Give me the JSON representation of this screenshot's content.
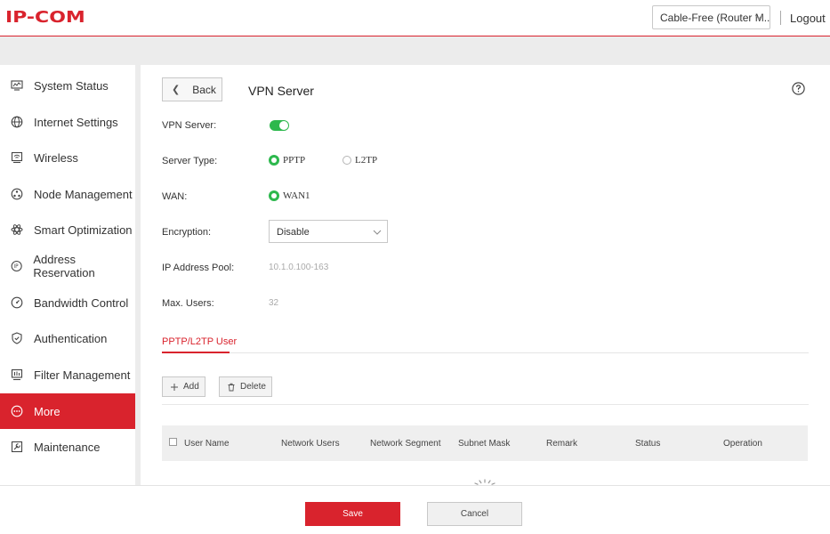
{
  "header": {
    "logo": "IP-COM",
    "mode_select_value": "Cable-Free (Router M...",
    "logout": "Logout"
  },
  "sidebar": {
    "items": [
      {
        "label": "System Status",
        "icon": "monitor-icon"
      },
      {
        "label": "Internet Settings",
        "icon": "globe-icon"
      },
      {
        "label": "Wireless",
        "icon": "wireless-icon"
      },
      {
        "label": "Node Management",
        "icon": "node-icon"
      },
      {
        "label": "Smart Optimization",
        "icon": "optimize-icon"
      },
      {
        "label": "Address Reservation",
        "icon": "ip-reservation-icon"
      },
      {
        "label": "Bandwidth Control",
        "icon": "gauge-icon"
      },
      {
        "label": "Authentication",
        "icon": "shield-check-icon"
      },
      {
        "label": "Filter Management",
        "icon": "filter-icon"
      },
      {
        "label": "More",
        "icon": "more-icon",
        "active": true
      },
      {
        "label": "Maintenance",
        "icon": "wrench-icon"
      }
    ]
  },
  "main": {
    "back_label": "Back",
    "title": "VPN Server",
    "fields": {
      "vpn_server_label": "VPN Server:",
      "vpn_server_enabled": true,
      "server_type_label": "Server Type:",
      "server_type_options": [
        "PPTP",
        "L2TP"
      ],
      "server_type_selected": "PPTP",
      "wan_label": "WAN:",
      "wan_option": "WAN1",
      "encryption_label": "Encryption:",
      "encryption_value": "Disable",
      "ip_pool_label": "IP Address Pool:",
      "ip_pool_value": "10.1.0.100-163",
      "max_users_label": "Max. Users:",
      "max_users_value": "32"
    },
    "tab_label": "PPTP/L2TP User",
    "add_label": "Add",
    "delete_label": "Delete",
    "table_headers": [
      "User Name",
      "Network Users",
      "Network Segment",
      "Subnet Mask",
      "Remark",
      "Status",
      "Operation"
    ]
  },
  "footer": {
    "save_label": "Save",
    "cancel_label": "Cancel"
  },
  "colors": {
    "brand_red": "#d9232d",
    "toggle_green": "#2db84d"
  }
}
